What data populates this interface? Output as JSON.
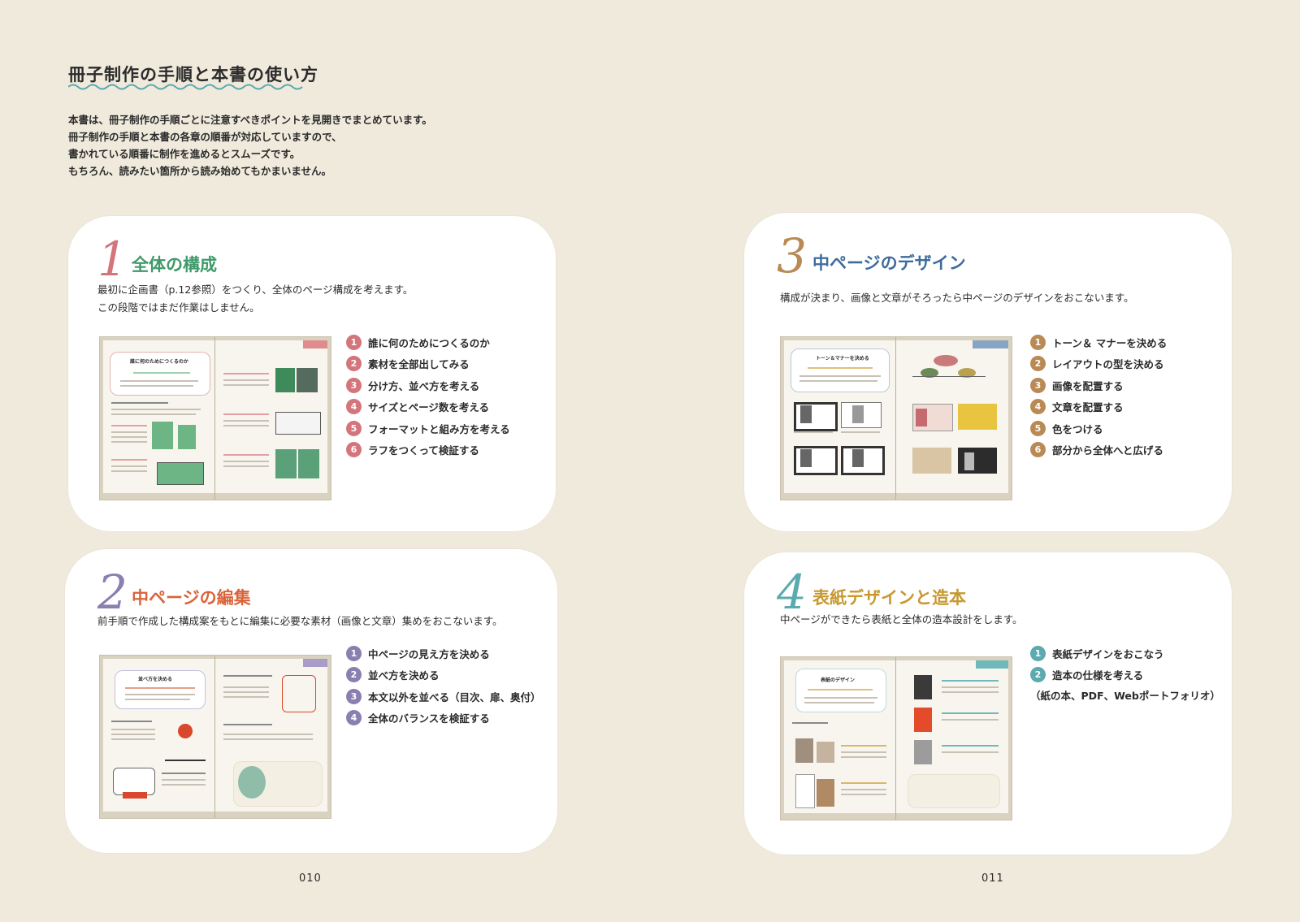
{
  "intro": {
    "title": "冊子制作の手順と本書の使い方",
    "lines": [
      "本書は、冊子制作の手順ごとに注意すべきポイントを見開きでまとめています。",
      "冊子制作の手順と本書の各章の順番が対応していますので、",
      "書かれている順番に制作を進めるとスムーズです。",
      "もちろん、読みたい箇所から読み始めてもかまいません。"
    ]
  },
  "colors": {
    "background": "#efeadc",
    "sec1": "#d4757b",
    "sec1_title": "#3f9a6a",
    "sec2": "#8a7fb0",
    "sec2_title": "#d9643a",
    "sec3": "#b98a55",
    "sec3_title": "#3e6c9e",
    "sec4": "#5aaab0",
    "sec4_title": "#c7982e"
  },
  "sections": [
    {
      "number": "1",
      "title": "全体の構成",
      "desc": [
        "最初に企画書（p.12参照）をつくり、全体のページ構成を考えます。",
        "この段階ではまだ作業はしません。"
      ],
      "steps": [
        {
          "n": "1",
          "label": "誰に何のためにつくるのか"
        },
        {
          "n": "2",
          "label": "素材を全部出してみる"
        },
        {
          "n": "3",
          "label": "分け方、並べ方を考える"
        },
        {
          "n": "4",
          "label": "サイズとページ数を考える"
        },
        {
          "n": "5",
          "label": "フォーマットと組み方を考える"
        },
        {
          "n": "6",
          "label": "ラフをつくって検証する"
        }
      ],
      "thumb_heading": "誰に何のためにつくるのか"
    },
    {
      "number": "2",
      "title": "中ページの編集",
      "desc": [
        "前手順で作成した構成案をもとに編集に必要な素材（画像と文章）集めをおこないます。"
      ],
      "steps": [
        {
          "n": "1",
          "label": "中ページの見え方を決める"
        },
        {
          "n": "2",
          "label": "並べ方を決める"
        },
        {
          "n": "3",
          "label": "本文以外を並べる（目次、扉、奥付）"
        },
        {
          "n": "4",
          "label": "全体のバランスを検証する"
        }
      ],
      "thumb_heading": "並べ方を決める"
    },
    {
      "number": "3",
      "title": "中ページのデザイン",
      "desc": [
        "構成が決まり、画像と文章がそろったら中ページのデザインをおこないます。"
      ],
      "steps": [
        {
          "n": "1",
          "label": "トーン＆ マナーを決める"
        },
        {
          "n": "2",
          "label": "レイアウトの型を決める"
        },
        {
          "n": "3",
          "label": "画像を配置する"
        },
        {
          "n": "4",
          "label": "文章を配置する"
        },
        {
          "n": "5",
          "label": "色をつける"
        },
        {
          "n": "6",
          "label": "部分から全体へと広げる"
        }
      ],
      "thumb_heading": "トーン＆マナーを決める"
    },
    {
      "number": "4",
      "title": "表紙デザインと造本",
      "desc": [
        "中ページができたら表紙と全体の造本設計をします。"
      ],
      "steps": [
        {
          "n": "1",
          "label": "表紙デザインをおこなう"
        },
        {
          "n": "2",
          "label": "造本の仕様を考える"
        }
      ],
      "steps_note": "（紙の本、PDF、Webポートフォリオ）",
      "thumb_heading": "表紙のデザイン"
    }
  ],
  "page_numbers": {
    "left": "010",
    "right": "011"
  }
}
